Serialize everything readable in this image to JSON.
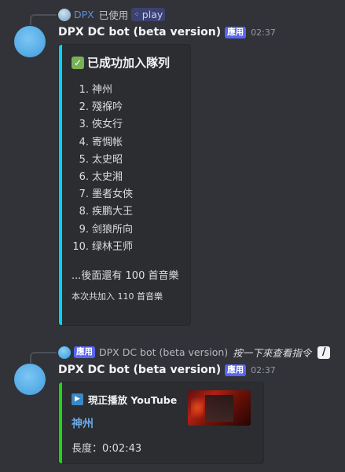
{
  "message1": {
    "reply": {
      "user": "DPX",
      "action": "已使用",
      "command": "play"
    },
    "author": "DPX DC bot (beta version)",
    "app_tag": "應用",
    "timestamp": "02:37",
    "embed": {
      "accent_color": "#00d4f4",
      "title": "已成功加入隊列",
      "queue": [
        {
          "num": "1.",
          "title": "神州"
        },
        {
          "num": "2.",
          "title": "殘褓吟"
        },
        {
          "num": "3.",
          "title": "俠女行"
        },
        {
          "num": "4.",
          "title": "寄惆帐"
        },
        {
          "num": "5.",
          "title": "太史昭"
        },
        {
          "num": "6.",
          "title": "太史湘"
        },
        {
          "num": "7.",
          "title": "墨者女俠"
        },
        {
          "num": "8.",
          "title": "疾鹏大王"
        },
        {
          "num": "9.",
          "title": "剑狼所向"
        },
        {
          "num": "10.",
          "title": "绿林王师"
        }
      ],
      "more": "...後面還有 100 首音樂",
      "total": "本次共加入 110 首音樂"
    }
  },
  "message2": {
    "reply": {
      "app_tag": "應用",
      "user": "DPX DC bot (beta version)",
      "text": "按一下來查看指令"
    },
    "author": "DPX DC bot (beta version)",
    "app_tag": "應用",
    "timestamp": "02:37",
    "embed": {
      "accent_color": "#1ed515",
      "title": "現正播放 YouTube",
      "song": "神州",
      "duration": "長度：0:02:43"
    }
  }
}
